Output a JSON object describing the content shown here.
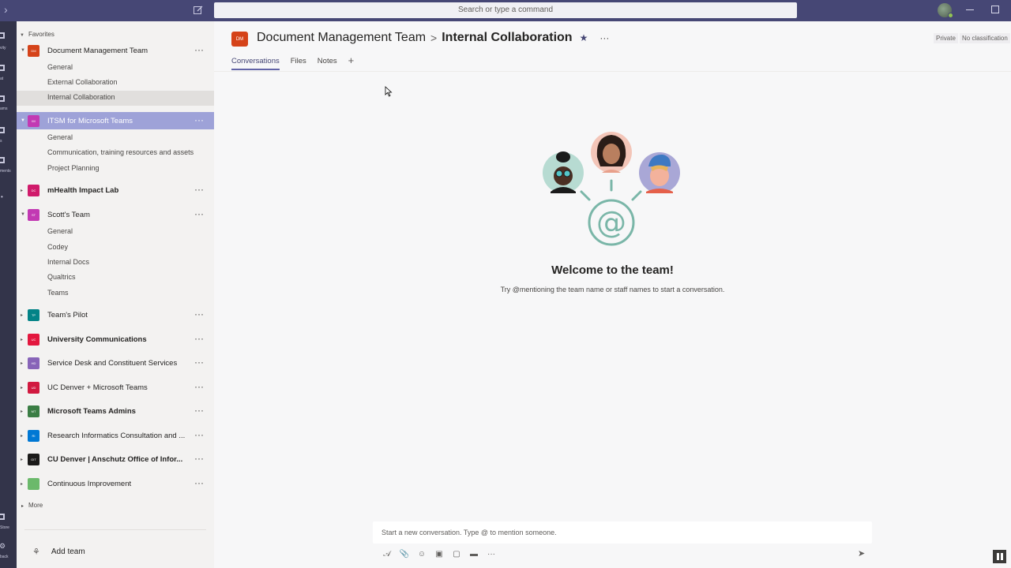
{
  "search": {
    "placeholder": "Search or type a command"
  },
  "colors": {
    "topbar": "#464775",
    "accent": "#6264a7"
  },
  "rail": {
    "labels": [
      "vity",
      "at",
      "ams",
      "s",
      "ments",
      "Store",
      "back"
    ]
  },
  "sidebar": {
    "favorites_label": "Favorites",
    "teams": [
      {
        "abbr": "DM",
        "name": "Document Management Team",
        "bold": false,
        "color": "#d54319",
        "channels": [
          "General",
          "External Collaboration",
          "Internal Collaboration"
        ]
      },
      {
        "abbr": "IM",
        "name": "ITSM for Microsoft Teams",
        "bold": false,
        "color": "#c239b3",
        "channels": [
          "General",
          "Communication, training resources and assets",
          "Project Planning"
        ]
      },
      {
        "abbr": "DC",
        "name": "mHealth Impact Lab",
        "bold": true,
        "color": "#d01b6b",
        "channels": []
      },
      {
        "abbr": "ST",
        "name": "Scott's Team",
        "bold": false,
        "color": "#c239b3",
        "channels": [
          "General",
          "Codey",
          "Internal Docs",
          "Qualtrics",
          "Teams"
        ]
      },
      {
        "abbr": "TP",
        "name": "Team's Pilot",
        "bold": false,
        "color": "#038387",
        "channels": []
      },
      {
        "abbr": "UC",
        "name": "University Communications",
        "bold": true,
        "color": "#e3173e",
        "channels": []
      },
      {
        "abbr": "HD",
        "name": "Service Desk and Constituent Services",
        "bold": false,
        "color": "#8764b8",
        "channels": []
      },
      {
        "abbr": "UD",
        "name": "UC Denver + Microsoft Teams",
        "bold": false,
        "color": "#d1193f",
        "channels": []
      },
      {
        "abbr": "MT",
        "name": "Microsoft Teams Admins",
        "bold": true,
        "color": "#3a7d44",
        "channels": []
      },
      {
        "abbr": "RI",
        "name": "Research Informatics Consultation and ...",
        "bold": false,
        "color": "#0078d4",
        "channels": []
      },
      {
        "abbr": "OIT",
        "name": "CU Denver | Anschutz Office of Infor...",
        "bold": true,
        "color": "#1b1a19",
        "channels": []
      },
      {
        "abbr": "",
        "name": "Continuous Improvement",
        "bold": false,
        "color": "#6bb96b",
        "channels": []
      }
    ],
    "more_label": "More",
    "add_team_label": "Add team"
  },
  "header": {
    "team_abbr": "DM",
    "team_name": "Document Management Team",
    "separator": ">",
    "channel_name": "Internal Collaboration",
    "tag_private": "Private",
    "tag_classification": "No classification"
  },
  "tabs": [
    {
      "label": "Conversations",
      "active": true
    },
    {
      "label": "Files",
      "active": false
    },
    {
      "label": "Notes",
      "active": false
    }
  ],
  "welcome": {
    "title": "Welcome to the team!",
    "subtitle": "Try @mentioning the team name or staff names to start a conversation."
  },
  "compose": {
    "placeholder": "Start a new conversation. Type @ to mention someone."
  }
}
